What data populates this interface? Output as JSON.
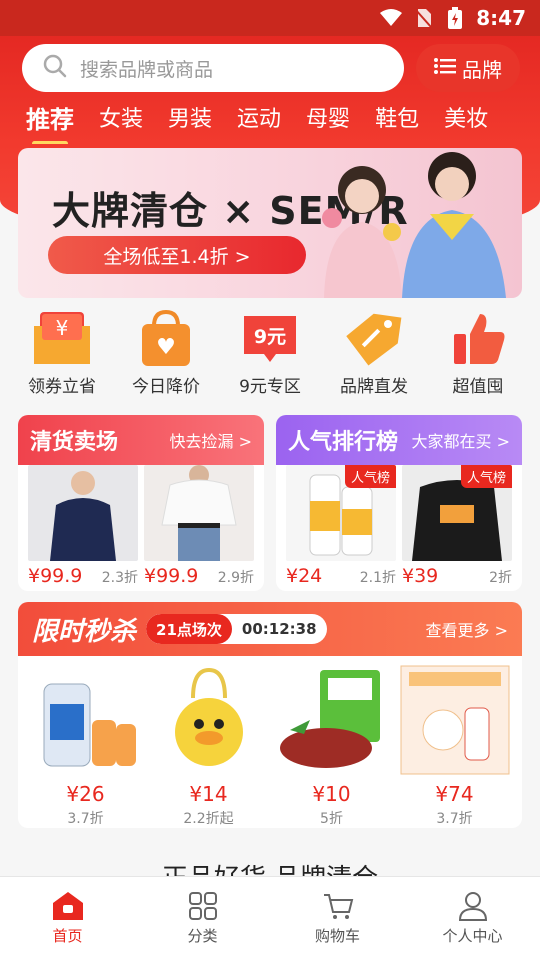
{
  "status_bar": {
    "time": "8:47"
  },
  "search": {
    "placeholder": "搜索品牌或商品",
    "brand_button": "品牌"
  },
  "tabs": [
    "推荐",
    "女装",
    "男装",
    "运动",
    "母婴",
    "鞋包",
    "美妆"
  ],
  "banner": {
    "title": "大牌清仓 × SEM/R",
    "button": "全场低至1.4折 >"
  },
  "quick_icons": [
    {
      "label": "领券立省",
      "glyph": "¥",
      "icon": "coupon-icon"
    },
    {
      "label": "今日降价",
      "glyph": "♥",
      "icon": "price-drop-bag-icon"
    },
    {
      "label": "9元专区",
      "glyph": "9元",
      "icon": "nine-yuan-icon"
    },
    {
      "label": "品牌直发",
      "glyph": "",
      "icon": "brand-tag-icon"
    },
    {
      "label": "超值囤",
      "glyph": "",
      "icon": "thumbs-up-icon"
    }
  ],
  "clearance": {
    "title": "清货卖场",
    "more": "快去捡漏 >",
    "items": [
      {
        "price": "¥99.9",
        "discount": "2.3折"
      },
      {
        "price": "¥99.9",
        "discount": "2.9折"
      }
    ]
  },
  "ranking": {
    "title": "人气排行榜",
    "more": "大家都在买 >",
    "badge": "人气榜",
    "items": [
      {
        "price": "¥24",
        "discount": "2.1折"
      },
      {
        "price": "¥39",
        "discount": "2折"
      }
    ]
  },
  "flash_sale": {
    "title": "限时秒杀",
    "session": "21点场次",
    "countdown": "00:12:38",
    "more": "查看更多 >",
    "items": [
      {
        "price": "¥26",
        "discount": "3.7折"
      },
      {
        "price": "¥14",
        "discount": "2.2折起"
      },
      {
        "price": "¥10",
        "discount": "5折"
      },
      {
        "price": "¥74",
        "discount": "3.7折"
      }
    ]
  },
  "slogan": "正品好货 品牌清仓",
  "bottom_nav": [
    "首页",
    "分类",
    "购物车",
    "个人中心"
  ],
  "colors": {
    "primary": "#e8281f",
    "ranking": "#9b63f0",
    "clearance": "#f0424c"
  }
}
